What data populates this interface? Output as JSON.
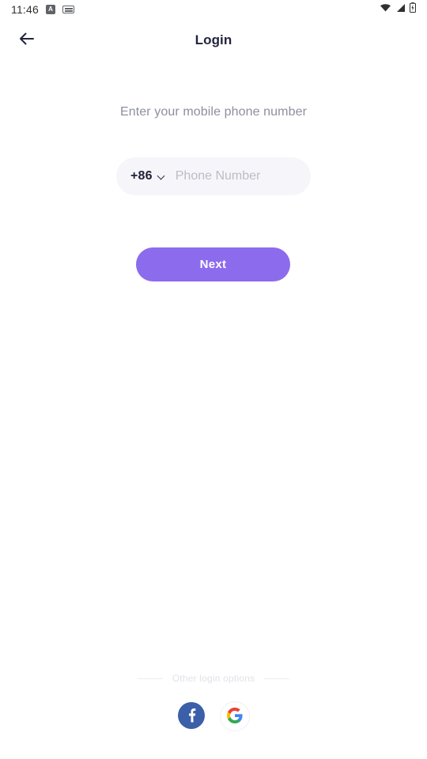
{
  "status_bar": {
    "clock": "11:46",
    "badge_letter": "A",
    "icons": [
      "notification-badge-a-icon",
      "keyboard-icon",
      "wifi-icon",
      "cellular-signal-icon",
      "battery-charging-icon"
    ]
  },
  "header": {
    "title": "Login",
    "back_icon": "arrow-left-icon"
  },
  "main": {
    "prompt": "Enter your mobile phone number",
    "phone": {
      "country_code": "+86",
      "placeholder": "Phone Number",
      "value": "",
      "chevron_icon": "chevron-down-icon"
    },
    "next_label": "Next"
  },
  "footer": {
    "alt_login_label": "Other login options",
    "social": [
      {
        "name": "facebook",
        "label": "f"
      },
      {
        "name": "google",
        "label": "G"
      }
    ]
  },
  "colors": {
    "accent": "#8c6bed",
    "title": "#22243c",
    "prompt": "#8d8f9e",
    "field_bg": "#f6f6fa",
    "placeholder": "#bcbcc6",
    "facebook": "#3b5fa8"
  }
}
